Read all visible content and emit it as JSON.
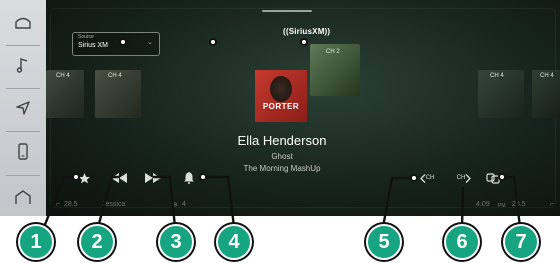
{
  "rail": {
    "items": [
      {
        "icon": "home-icon"
      },
      {
        "icon": "music-note-icon"
      },
      {
        "icon": "navigation-arrow-icon"
      },
      {
        "icon": "phone-icon"
      },
      {
        "icon": "home-outline-icon"
      }
    ]
  },
  "source": {
    "caption": "Source",
    "value": "Sirius XM",
    "chevron": "⌄"
  },
  "logo": "((SiriusXM))",
  "channels": {
    "left_1": "CH 4",
    "left_2": "CH 4",
    "top": "CH 2",
    "right_1": "CH 4",
    "right_2": "CH 4"
  },
  "album_art_title": "PORTER",
  "now_playing": {
    "artist": "Ella Henderson",
    "song": "Ghost",
    "album": "The Morning MashUp"
  },
  "controls": {
    "favorite": "star-icon",
    "rewind": "rewind-icon",
    "fast_forward": "fast-forward-icon",
    "alert": "bell-icon",
    "prev_channel": "CH",
    "next_channel": "CH",
    "repeat": "repeat-icon"
  },
  "status": {
    "temp_left": "28.5",
    "user": "Jessica",
    "fan": "4",
    "time": "4:09",
    "ampm": "PM",
    "temp_right": "28.5"
  },
  "callouts": [
    "1",
    "2",
    "3",
    "4",
    "5",
    "6",
    "7"
  ],
  "colors": {
    "badge": "#17a481",
    "screen": "#17231d",
    "rail": "#d0d3d6"
  }
}
